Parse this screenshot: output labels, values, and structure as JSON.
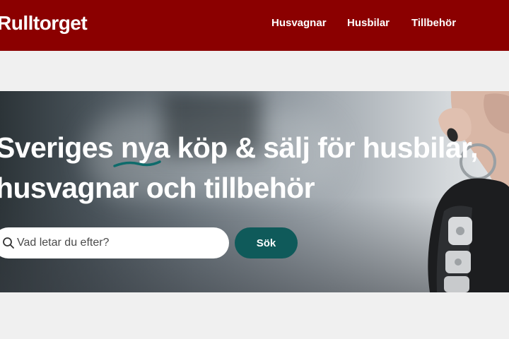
{
  "header": {
    "logo": "Rulltorget",
    "nav": [
      "Husvagnar",
      "Husbilar",
      "Tillbehör"
    ],
    "color": "#8b0000"
  },
  "hero": {
    "line1_a": "Sveriges ",
    "line1_highlight": "nya",
    "line1_b": " köp & sälj för husbilar,",
    "line2": "husvagnar och tillbehör",
    "underline_color": "#0e6b6b"
  },
  "search": {
    "placeholder": "Vad letar du efter?",
    "value": "",
    "button_label": "Sök",
    "button_color": "#0f5a5a"
  }
}
